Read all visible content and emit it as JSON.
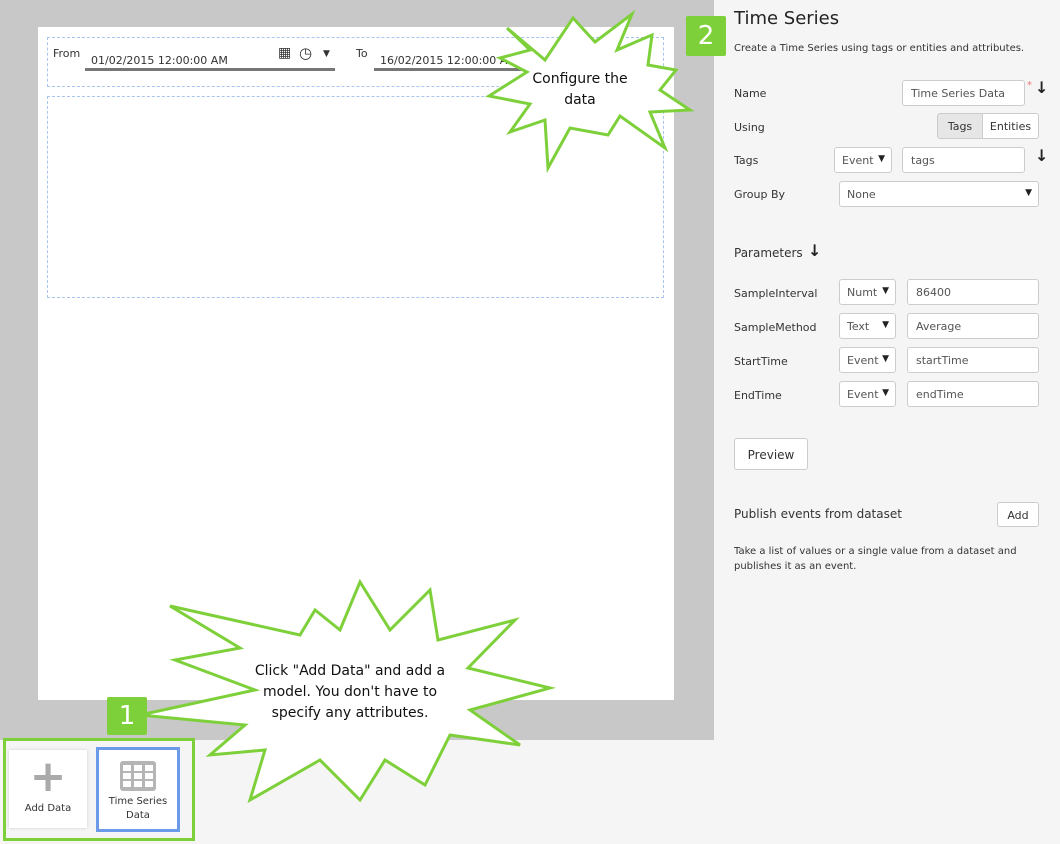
{
  "dashboard": {
    "from_label": "From",
    "from_value": "01/02/2015 12:00:00 AM",
    "to_label": "To",
    "to_value": "16/02/2015 12:00:00 AM"
  },
  "panel": {
    "title": "Time Series",
    "description": "Create a Time Series using tags or entities and attributes.",
    "name_label": "Name",
    "name_value": "Time Series Data",
    "required_mark": "*",
    "using_label": "Using",
    "using_options": [
      "Tags",
      "Entities"
    ],
    "using_selected": "Tags",
    "tags_label": "Tags",
    "tags_type": "Event",
    "tags_value": "tags",
    "group_by_label": "Group By",
    "group_by_value": "None",
    "parameters_label": "Parameters",
    "parameters": [
      {
        "name": "SampleInterval",
        "type": "Numt",
        "value": "86400"
      },
      {
        "name": "SampleMethod",
        "type": "Text",
        "value": "Average"
      },
      {
        "name": "StartTime",
        "type": "Event",
        "value": "startTime"
      },
      {
        "name": "EndTime",
        "type": "Event",
        "value": "endTime"
      }
    ],
    "preview_label": "Preview",
    "publish_label": "Publish events from dataset",
    "add_label": "Add",
    "publish_desc": "Take a list of values or a single value from a dataset and publishes it as an event."
  },
  "tray": {
    "add_data": "Add Data",
    "time_series": "Time Series Data"
  },
  "callouts": {
    "step1": "1",
    "step2": "2",
    "configure": "Configure the data",
    "add_data_hint": "Click \"Add Data\" and add a model. You don't have to specify any attributes."
  },
  "colors": {
    "accent_green": "#7ed03b",
    "selection_blue": "#6b9be8"
  }
}
